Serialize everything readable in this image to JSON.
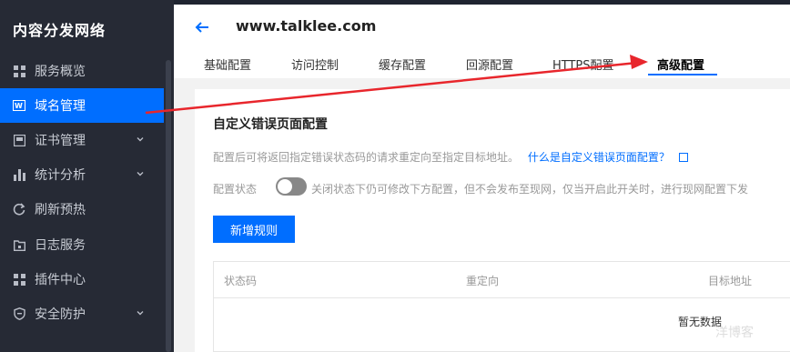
{
  "sidebar": {
    "brand": "内容分发网络",
    "items": [
      {
        "label": "服务概览",
        "icon": "grid-icon",
        "active": false,
        "expandable": false
      },
      {
        "label": "域名管理",
        "icon": "domain-icon",
        "active": true,
        "expandable": false
      },
      {
        "label": "证书管理",
        "icon": "certificate-icon",
        "active": false,
        "expandable": true
      },
      {
        "label": "统计分析",
        "icon": "bar-chart-icon",
        "active": false,
        "expandable": true
      },
      {
        "label": "刷新预热",
        "icon": "refresh-icon",
        "active": false,
        "expandable": false
      },
      {
        "label": "日志服务",
        "icon": "log-icon",
        "active": false,
        "expandable": false
      },
      {
        "label": "插件中心",
        "icon": "plugin-icon",
        "active": false,
        "expandable": false
      },
      {
        "label": "安全防护",
        "icon": "shield-icon",
        "active": false,
        "expandable": true
      }
    ]
  },
  "header": {
    "domain": "www.talklee.com",
    "tabs": [
      "基础配置",
      "访问控制",
      "缓存配置",
      "回源配置",
      "HTTPS配置",
      "高级配置"
    ],
    "active_tab": "高级配置"
  },
  "section": {
    "title": "自定义错误页面配置",
    "description": "配置后可将返回指定错误状态码的请求重定向至指定目标地址。",
    "help_link": "什么是自定义错误页面配置？",
    "state_label": "配置状态",
    "state_desc": "关闭状态下仍可修改下方配置，但不会发布至现网，仅当开启此开关时，进行现网配置下发",
    "add_button": "新增规则",
    "table": {
      "columns": [
        "状态码",
        "重定向",
        "目标地址"
      ],
      "empty_text": "暂无数据"
    }
  },
  "watermark": "洋博客",
  "colors": {
    "accent": "#006eff",
    "sidebar_bg": "#262a35",
    "annotation": "#e8262c"
  }
}
